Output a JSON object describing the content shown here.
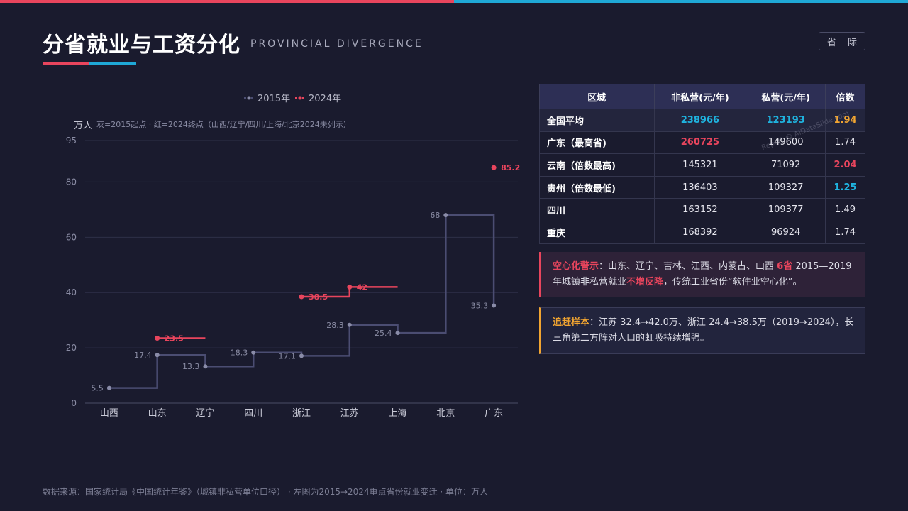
{
  "header": {
    "title": "分省就业与工资分化",
    "subtitle": "PROVINCIAL DIVERGENCE",
    "tag_button": "省 际"
  },
  "colors": {
    "accent_red": "#e8455d",
    "accent_cyan": "#1fa8d6",
    "accent_orange": "#f2a531",
    "line_gray": "#4b4d72"
  },
  "chart_data": {
    "type": "line",
    "step": true,
    "unit_label": "万人",
    "note": "灰=2015起点 · 红=2024终点（山西/辽宁/四川/上海/北京2024未列示）",
    "categories": [
      "山西",
      "山东",
      "辽宁",
      "四川",
      "浙江",
      "江苏",
      "上海",
      "北京",
      "广东"
    ],
    "y_ticks": [
      0,
      20,
      40,
      60,
      80,
      95
    ],
    "ylim": [
      0,
      95
    ],
    "grid": true,
    "legend_position": "top-center",
    "series": [
      {
        "name": "2015年",
        "color": "#4b4d72",
        "values": [
          5.5,
          17.4,
          13.3,
          18.3,
          17.1,
          28.3,
          25.4,
          68,
          35.3
        ],
        "labels": [
          "5.5",
          "17.4",
          "13.3",
          "18.3",
          "17.1",
          "28.3",
          "25.4",
          "68",
          "35.3"
        ]
      },
      {
        "name": "2024年",
        "color": "#e8455d",
        "values": [
          null,
          23.5,
          null,
          null,
          38.5,
          42,
          null,
          null,
          85.2
        ],
        "labels": [
          "",
          "23.5",
          "",
          "",
          "38.5",
          "42",
          "",
          "",
          "85.2"
        ]
      }
    ]
  },
  "table": {
    "headers": [
      "区域",
      "非私营(元/年)",
      "私营(元/年)",
      "倍数"
    ],
    "rows": [
      {
        "region": "全国平均",
        "nonprivate": "238966",
        "private": "123193",
        "ratio": "1.94"
      },
      {
        "region": "广东（最高省)",
        "nonprivate": "260725",
        "private": "149600",
        "ratio": "1.74"
      },
      {
        "region": "云南（倍数最高)",
        "nonprivate": "145321",
        "private": "71092",
        "ratio": "2.04"
      },
      {
        "region": "贵州（倍数最低)",
        "nonprivate": "136403",
        "private": "109327",
        "ratio": "1.25"
      },
      {
        "region": "四川",
        "nonprivate": "163152",
        "private": "109377",
        "ratio": "1.49"
      },
      {
        "region": "重庆",
        "nonprivate": "168392",
        "private": "96924",
        "ratio": "1.74"
      }
    ],
    "watermark": "Report @ AIDataSlide.com"
  },
  "callouts": {
    "c1": {
      "title": "空心化警示",
      "text_a": "：山东、辽宁、吉林、江西、内蒙古、山西 ",
      "highlight_count": "6省",
      "text_b": " 2015—2019年城镇非私营就业",
      "highlight_phrase": "不增反降",
      "text_c": "，传统工业省份“软件业空心化”。"
    },
    "c2": {
      "title": "追赶样本",
      "text": "：江苏 32.4→42.0万、浙江 24.4→38.5万（2019→2024），长三角第二方阵对人口的虹吸持续增强。"
    }
  },
  "footer": "数据来源：国家统计局《中国统计年鉴》（城镇非私营单位口径） · 左图为2015→2024重点省份就业变迁 · 单位：万人"
}
